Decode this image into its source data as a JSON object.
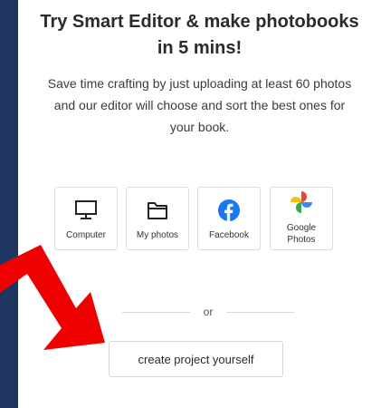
{
  "header": {
    "title_line1": "Try Smart Editor & make photobooks",
    "title_line2": "in 5 mins!",
    "subtitle_line1": "Save time crafting by just uploading at least 60 photos",
    "subtitle_line2": "and our editor will choose and sort the best ones for",
    "subtitle_line3": "your book."
  },
  "sources": [
    {
      "label": "Computer",
      "icon": "monitor-icon"
    },
    {
      "label": "My photos",
      "icon": "folder-icon"
    },
    {
      "label": "Facebook",
      "icon": "facebook-icon"
    },
    {
      "label_line1": "Google",
      "label_line2": "Photos",
      "icon": "google-photos-icon"
    }
  ],
  "divider": {
    "text": "or"
  },
  "actions": {
    "create_label": "create project yourself"
  },
  "colors": {
    "background": "#1e3560",
    "panel": "#ffffff",
    "arrow": "#ee0000",
    "facebook": "#1877f2"
  }
}
